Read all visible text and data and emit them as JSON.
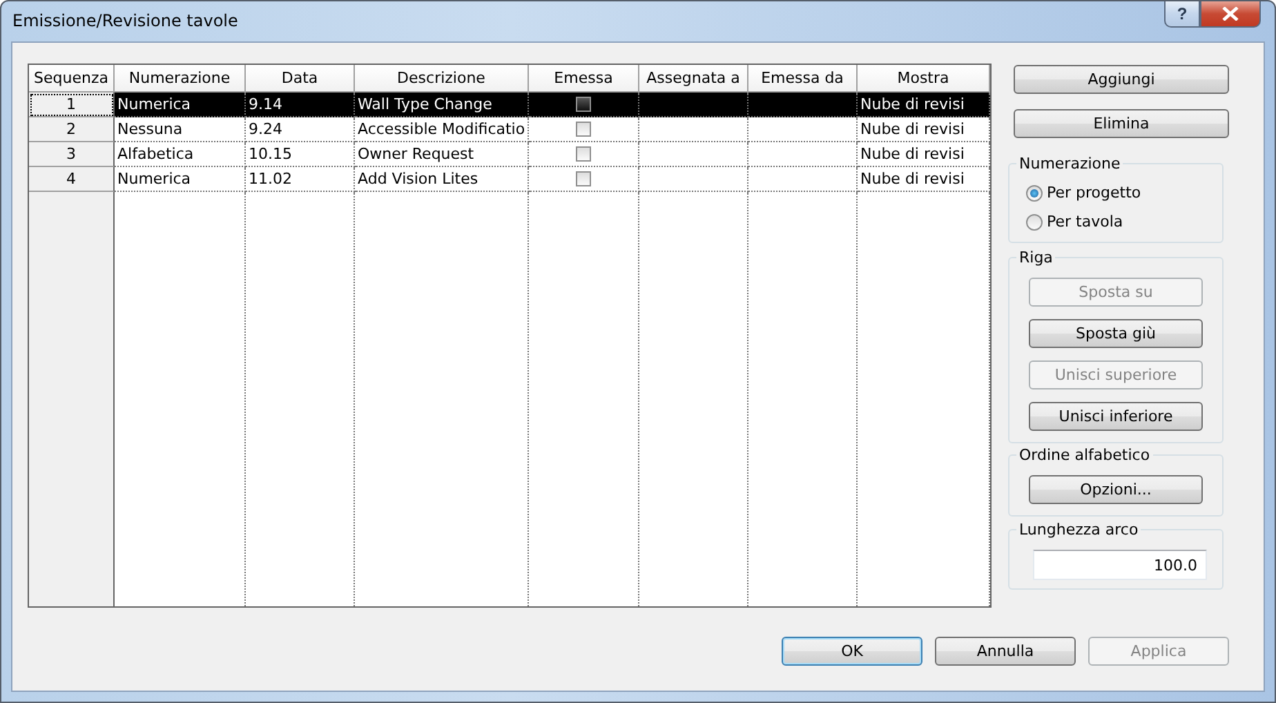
{
  "window": {
    "title": "Emissione/Revisione tavole",
    "help": "?"
  },
  "table": {
    "columns": [
      "Sequenza",
      "Numerazione",
      "Data",
      "Descrizione",
      "Emessa",
      "Assegnata a",
      "Emessa da",
      "Mostra"
    ],
    "rows": [
      {
        "sequence": "1",
        "numbering": "Numerica",
        "date": "9.14",
        "description": "Wall Type Change",
        "issued": false,
        "assigned_to": "",
        "issued_by": "",
        "show": "Nube di revisi",
        "selected": true
      },
      {
        "sequence": "2",
        "numbering": "Nessuna",
        "date": "9.24",
        "description": "Accessible Modificatio",
        "issued": false,
        "show": "Nube di revisi",
        "selected": false
      },
      {
        "sequence": "3",
        "numbering": "Alfabetica",
        "date": "10.15",
        "description": "Owner Request",
        "issued": false,
        "show": "Nube di revisi",
        "selected": false
      },
      {
        "sequence": "4",
        "numbering": "Numerica",
        "date": "11.02",
        "description": "Add Vision Lites",
        "issued": false,
        "show": "Nube di revisi",
        "selected": false
      }
    ]
  },
  "side_buttons": [
    {
      "label": "Aggiungi",
      "disabled": false
    },
    {
      "label": "Elimina",
      "disabled": false
    }
  ],
  "numbering_group": {
    "title": "Numerazione",
    "options": [
      {
        "label": "Per progetto",
        "selected": true
      },
      {
        "label": "Per tavola",
        "selected": false
      }
    ]
  },
  "row_group": {
    "title": "Riga",
    "buttons": [
      {
        "label": "Sposta su",
        "disabled": true
      },
      {
        "label": "Sposta giù",
        "disabled": false
      },
      {
        "label": "Unisci superiore",
        "disabled": true
      },
      {
        "label": "Unisci inferiore",
        "disabled": false
      }
    ]
  },
  "sort_group": {
    "title": "Ordine alfabetico",
    "buttons": [
      {
        "label": "Opzioni...",
        "disabled": false
      }
    ]
  },
  "arc_group": {
    "title": "Lunghezza arco",
    "value": "100.0"
  },
  "dialog_buttons": [
    {
      "label": "OK",
      "disabled": false,
      "default": true
    },
    {
      "label": "Annulla",
      "disabled": false,
      "default": false
    },
    {
      "label": "Applica",
      "disabled": true,
      "default": false
    }
  ]
}
